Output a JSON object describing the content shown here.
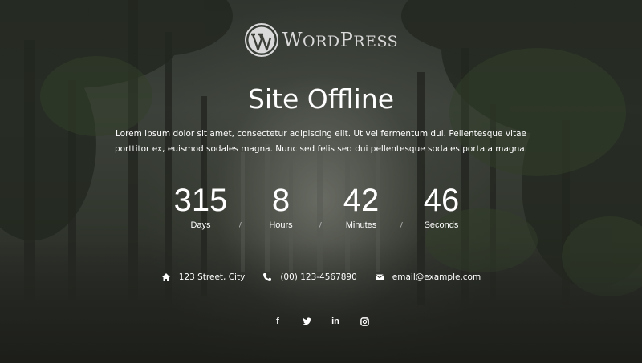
{
  "logo": {
    "big_w": "W",
    "rest1": "ORD",
    "big_p": "P",
    "rest2": "RESS"
  },
  "title": "Site Offline",
  "description_line1": "Lorem ipsum dolor sit amet, consectetur adipiscing elit. Ut vel fermentum dui. Pellentesque vitae",
  "description_line2": "porttitor ex, euismod sodales magna. Nunc sed felis sed dui pellentesque sodales porta a magna.",
  "countdown": {
    "days": {
      "value": "315",
      "label": "Days"
    },
    "hours": {
      "value": "8",
      "label": "Hours"
    },
    "minutes": {
      "value": "42",
      "label": "Minutes"
    },
    "seconds": {
      "value": "46",
      "label": "Seconds"
    },
    "separator": "/"
  },
  "contact": {
    "address": {
      "icon": "home-icon",
      "text": "123 Street, City"
    },
    "phone": {
      "icon": "phone-icon",
      "text": "(00) 123-4567890"
    },
    "email": {
      "icon": "envelope-icon",
      "text": "email@example.com"
    }
  },
  "social": [
    {
      "icon": "facebook-icon",
      "glyph": "f"
    },
    {
      "icon": "twitter-icon"
    },
    {
      "icon": "linkedin-icon",
      "glyph": "in"
    },
    {
      "icon": "instagram-icon"
    }
  ],
  "colors": {
    "text": "#ffffff",
    "logo": "#d9d9d9"
  }
}
